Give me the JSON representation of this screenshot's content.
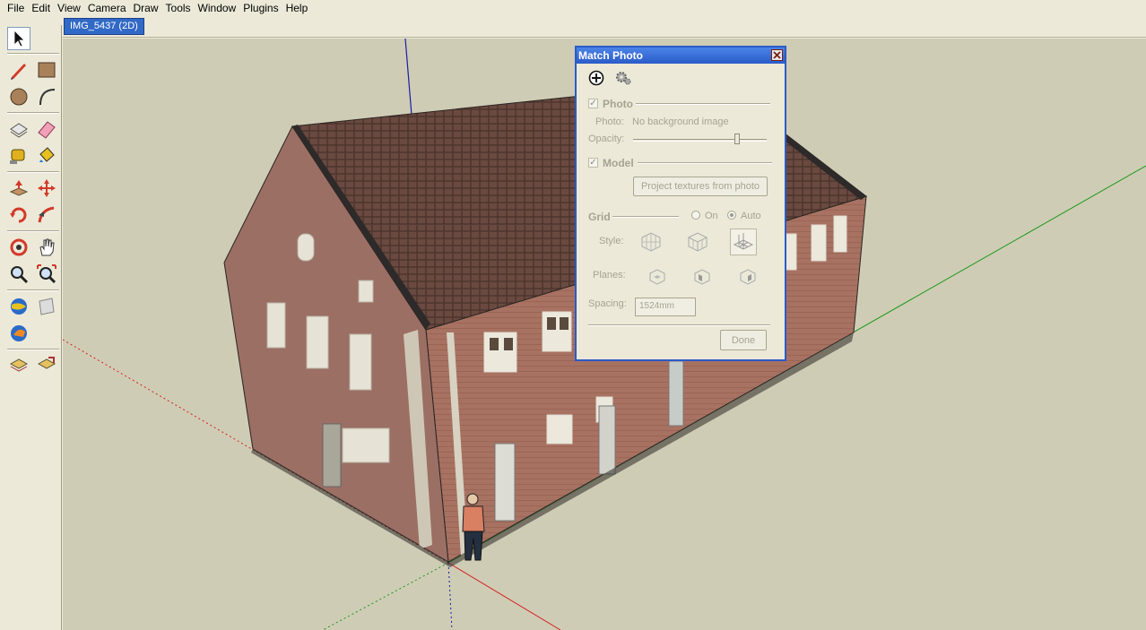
{
  "menu": [
    "File",
    "Edit",
    "View",
    "Camera",
    "Draw",
    "Tools",
    "Window",
    "Plugins",
    "Help"
  ],
  "scene_tab": "IMG_5437 (2D)",
  "toolbar": {
    "tools": [
      "select-tool",
      "pencil-tool",
      "rectangle-tool",
      "circle-tool",
      "arc-tool",
      "make-component-tool",
      "eraser-tool",
      "tape-measure-tool",
      "paint-bucket-tool",
      "push-pull-tool",
      "move-tool",
      "rotate-tool",
      "follow-me-tool",
      "orbit-tool",
      "pan-tool",
      "zoom-tool",
      "zoom-extents-tool",
      "get-models-tool",
      "share-model-tool",
      "google-earth-tool",
      "warehouse-upload-tool",
      "previous-view-tool",
      "next-view-tool"
    ]
  },
  "dialog": {
    "title": "Match Photo",
    "photo_section": "Photo",
    "photo_label": "Photo:",
    "photo_value": "No background image",
    "opacity_label": "Opacity:",
    "opacity_level": 0.78,
    "model_section": "Model",
    "project_button": "Project textures from photo",
    "grid_label": "Grid",
    "grid_on": "On",
    "grid_auto": "Auto",
    "style_label": "Style:",
    "planes_label": "Planes:",
    "spacing_label": "Spacing:",
    "spacing_value": "1524mm",
    "done_button": "Done"
  },
  "colors": {
    "axis_red": "#d42020",
    "axis_green": "#1a9a1a",
    "axis_blue": "#1a1aa8",
    "title_bar": "#2a5bc8",
    "selected_tab": "#3169c6"
  }
}
